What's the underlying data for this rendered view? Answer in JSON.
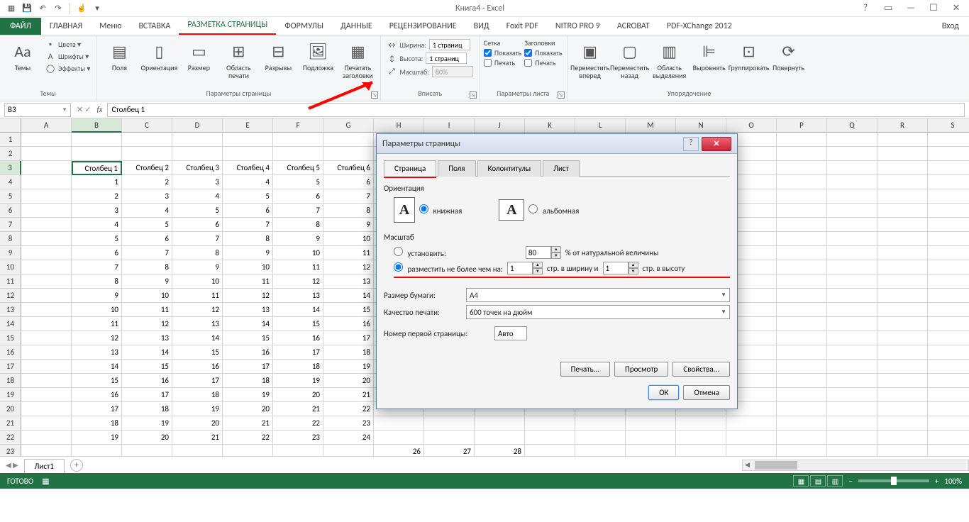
{
  "app_title": "Книга4 - Excel",
  "tabs": {
    "file": "ФАЙЛ",
    "list": [
      "ГЛАВНАЯ",
      "Меню",
      "ВСТАВКА",
      "РАЗМЕТКА СТРАНИЦЫ",
      "ФОРМУЛЫ",
      "ДАННЫЕ",
      "РЕЦЕНЗИРОВАНИЕ",
      "ВИД",
      "Foxit PDF",
      "NITRO PRO 9",
      "ACROBAT",
      "PDF-XChange 2012"
    ],
    "login": "Вход"
  },
  "ribbon": {
    "themes": {
      "btn": "Темы",
      "colors": "Цвета ▾",
      "fonts": "Шрифты ▾",
      "effects": "Эффекты ▾",
      "group": "Темы"
    },
    "page": {
      "margins": "Поля",
      "orientation": "Ориентация",
      "size": "Размер",
      "area": "Область печати",
      "breaks": "Разрывы",
      "bg": "Подложка",
      "titles": "Печатать заголовки",
      "group": "Параметры страницы"
    },
    "fit": {
      "width": "Ширина:",
      "width_v": "1 страниц",
      "height": "Высота:",
      "height_v": "1 страниц",
      "scale": "Масштаб:",
      "scale_v": "80%",
      "group": "Вписать"
    },
    "sheetopt": {
      "grid": "Сетка",
      "headings": "Заголовки",
      "show": "Показать",
      "print": "Печать",
      "group": "Параметры листа"
    },
    "arrange": {
      "fwd": "Переместить вперед",
      "back": "Переместить назад",
      "pane": "Область выделения",
      "align": "Выровнять",
      "group_btn": "Группировать",
      "rotate": "Повернуть",
      "group": "Упорядочение"
    }
  },
  "namebox": "B3",
  "formula": "Столбец 1",
  "columns": [
    "A",
    "B",
    "C",
    "D",
    "E",
    "F",
    "G",
    "H",
    "I",
    "J",
    "K",
    "L",
    "M",
    "N",
    "O",
    "P",
    "Q",
    "R",
    "S"
  ],
  "headers": [
    "Столбец 1",
    "Столбец 2",
    "Столбец 3",
    "Столбец 4",
    "Столбец 5",
    "Столбец 6"
  ],
  "data_start": 1,
  "tail_row": [
    "26",
    "27",
    "28"
  ],
  "sheet_tab": "Лист1",
  "status": {
    "ready": "ГОТОВО",
    "zoom": "100%"
  },
  "dialog": {
    "title": "Параметры страницы",
    "tabs": [
      "Страница",
      "Поля",
      "Колонтитулы",
      "Лист"
    ],
    "orient": {
      "title": "Ориентация",
      "portrait": "книжная",
      "landscape": "альбомная"
    },
    "scale": {
      "title": "Масштаб",
      "set": "установить:",
      "set_v": "80",
      "set_suffix": "% от натуральной величины",
      "fit": "разместить не более чем на:",
      "fit_w": "1",
      "fit_mid": "стр. в ширину и",
      "fit_h": "1",
      "fit_suffix": "стр. в высоту"
    },
    "paper": {
      "label": "Размер бумаги:",
      "value": "A4"
    },
    "quality": {
      "label": "Качество печати:",
      "value": "600 точек на дюйм"
    },
    "firstpage": {
      "label": "Номер первой страницы:",
      "value": "Авто"
    },
    "print": "Печать...",
    "preview": "Просмотр",
    "props": "Свойства...",
    "ok": "ОК",
    "cancel": "Отмена"
  }
}
